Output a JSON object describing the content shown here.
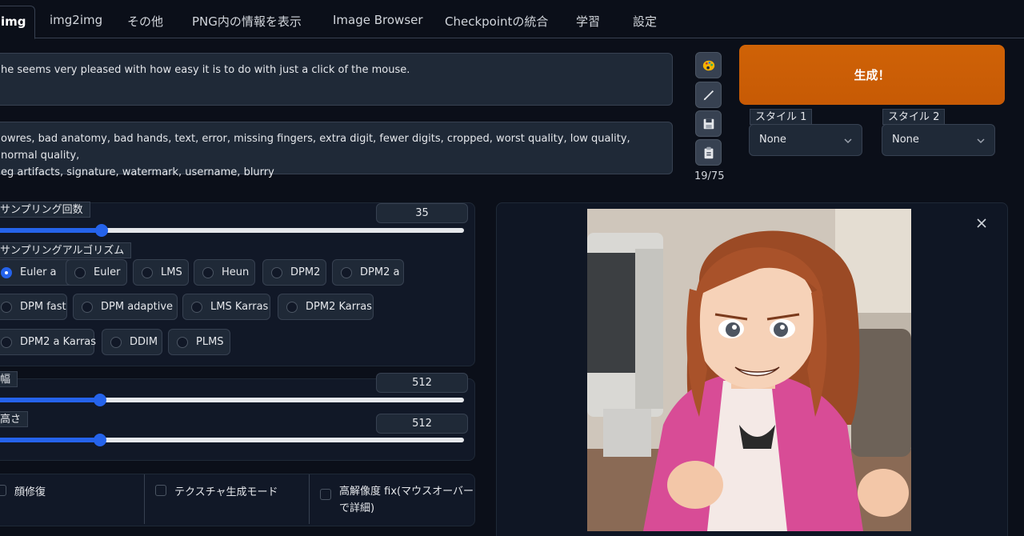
{
  "tabs": [
    {
      "label": "img"
    },
    {
      "label": "img2img"
    },
    {
      "label": "その他"
    },
    {
      "label": "PNG内の情報を表示"
    },
    {
      "label": "Image Browser"
    },
    {
      "label": "Checkpointの統合"
    },
    {
      "label": "学習"
    },
    {
      "label": "設定"
    }
  ],
  "prompt": {
    "positive_line": "he seems very pleased with how easy it is to do with just a click of the mouse.",
    "negative_line1": "owres, bad anatomy, bad hands, text, error, missing fingers, extra digit, fewer digits, cropped, worst quality, low quality, normal quality,",
    "negative_line2": "eg artifacts, signature, watermark, username, blurry",
    "token_count": "19/75"
  },
  "toolbar": {
    "icons": [
      "palette-icon",
      "pencil-icon",
      "save-icon",
      "clipboard-icon"
    ]
  },
  "generate": {
    "label": "生成！"
  },
  "styles": [
    {
      "label": "スタイル 1",
      "value": "None"
    },
    {
      "label": "スタイル 2",
      "value": "None"
    }
  ],
  "sampling_steps": {
    "label": "サンプリング回数",
    "value": "35",
    "fraction": 0.233
  },
  "sampler": {
    "label": "サンプリングアルゴリズム",
    "options": [
      "Euler a",
      "Euler",
      "LMS",
      "Heun",
      "DPM2",
      "DPM2 a",
      "DPM fast",
      "DPM adaptive",
      "LMS Karras",
      "DPM2 Karras",
      "DPM2 a Karras",
      "DDIM",
      "PLMS"
    ],
    "selected": "Euler a"
  },
  "width": {
    "label": "幅",
    "value": "512",
    "fraction": 0.229
  },
  "height": {
    "label": "高さ",
    "value": "512",
    "fraction": 0.229
  },
  "options": {
    "face_restore": "顔修復",
    "tiling": "テクスチャ生成モード",
    "hires_line1": "高解像度 fix(マウスオーバー",
    "hires_line2": "で詳細)"
  },
  "colors": {
    "accent": "#2563eb",
    "generate": "#c75a05",
    "background": "#0b0f19"
  }
}
